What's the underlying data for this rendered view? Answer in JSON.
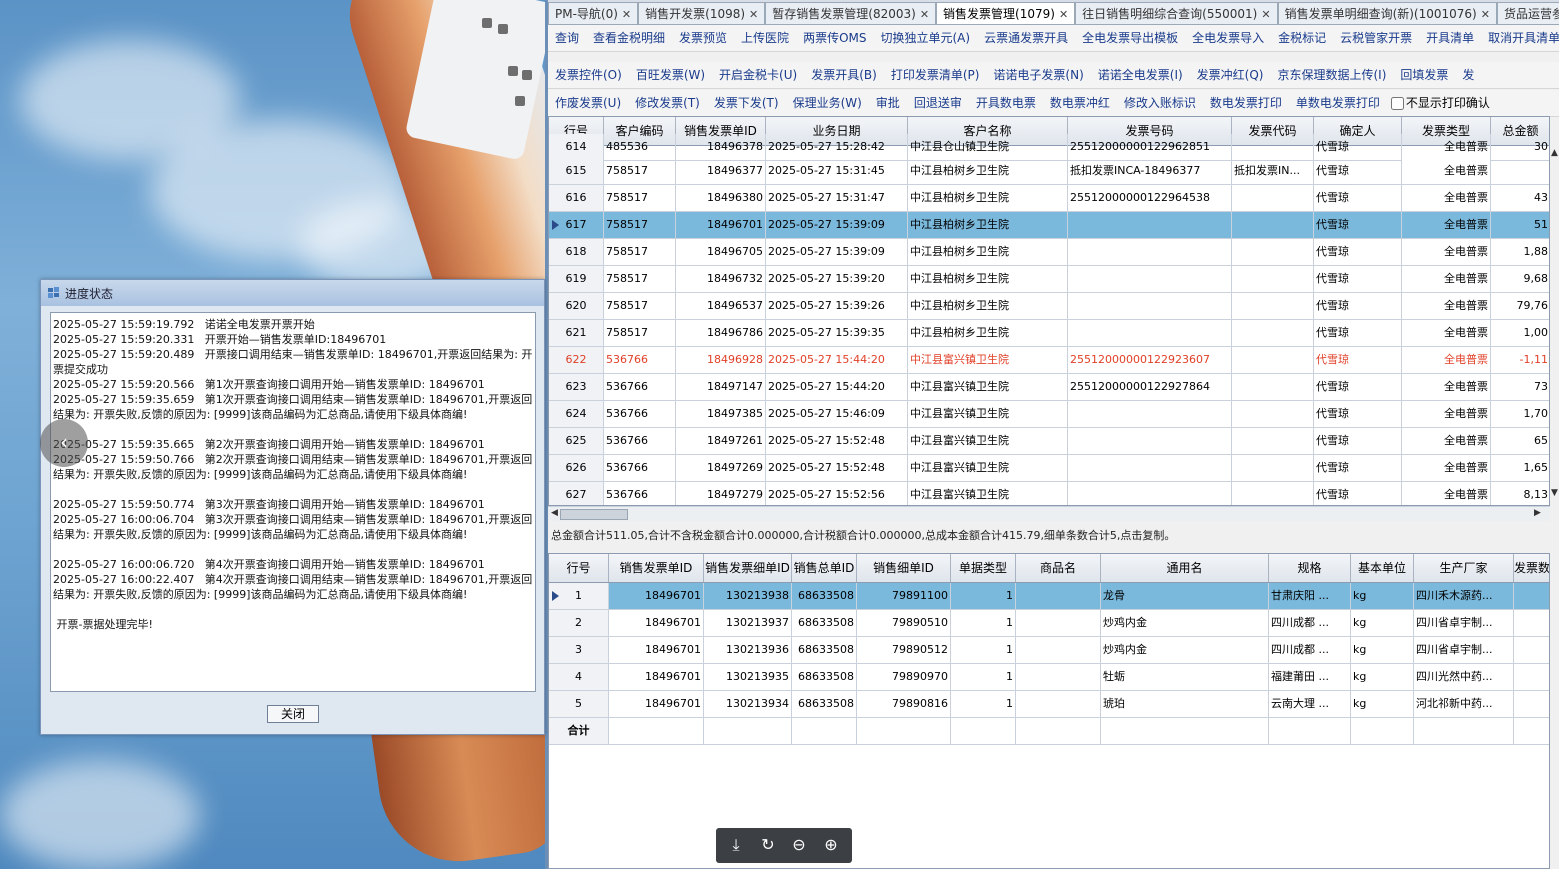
{
  "tabs": [
    {
      "label": "PM-导航(0)"
    },
    {
      "label": "销售开发票(1098)"
    },
    {
      "label": "暂存销售发票管理(82003)"
    },
    {
      "label": "销售发票管理(1079)",
      "active": true
    },
    {
      "label": "往日销售明细综合查询(550001)"
    },
    {
      "label": "销售发票单明细查询(新)(1001076)"
    },
    {
      "label": "货品运营参数设置"
    }
  ],
  "toolbar1": [
    "查询",
    "查看金税明细",
    "发票预览",
    "上传医院",
    "两票传OMS",
    "切换独立单元(A)",
    "云票通发票开具",
    "全电发票导出模板",
    "全电发票导入",
    "金税标记",
    "云税管家开票",
    "开具清单",
    "取消开具清单"
  ],
  "toolbar2": [
    "发票控件(O)",
    "百旺发票(W)",
    "开启金税卡(U)",
    "发票开具(B)",
    "打印发票清单(P)",
    "诺诺电子发票(N)",
    "诺诺全电发票(I)",
    "发票冲红(Q)",
    "京东保理数据上传(I)",
    "回填发票",
    "发"
  ],
  "toolbar3": [
    "作废发票(U)",
    "修改发票(T)",
    "发票下发(T)",
    "保理业务(W)",
    "审批",
    "回退送审",
    "开具数电票",
    "数电票冲红",
    "修改入账标识",
    "数电发票打印",
    "单数电发票打印"
  ],
  "toolbar3_checkbox": "不显示打印确认",
  "main_grid": {
    "headers": [
      "行号",
      "客户编码",
      "销售发票单ID",
      "业务日期",
      "客户名称",
      "发票号码",
      "发票代码",
      "确定人",
      "发票类型",
      "总金额"
    ],
    "partial_row": [
      "614",
      "485536",
      "18496378",
      "2025-05-27 15:28:42",
      "中江县仓山镇卫生院",
      "25512000000122962851",
      "",
      "代雪琼",
      "全电普票",
      "30"
    ],
    "rows": [
      [
        "615",
        "758517",
        "18496377",
        "2025-05-27 15:31:45",
        "中江县柏树乡卫生院",
        "抵扣发票INCA-18496377",
        "抵扣发票IN...",
        "代雪琼",
        "全电普票",
        ""
      ],
      [
        "616",
        "758517",
        "18496380",
        "2025-05-27 15:31:47",
        "中江县柏树乡卫生院",
        "25512000000122964538",
        "",
        "代雪琼",
        "全电普票",
        "43"
      ],
      [
        "617",
        "758517",
        "18496701",
        "2025-05-27 15:39:09",
        "中江县柏树乡卫生院",
        "",
        "",
        "代雪琼",
        "全电普票",
        "51"
      ],
      [
        "618",
        "758517",
        "18496705",
        "2025-05-27 15:39:09",
        "中江县柏树乡卫生院",
        "",
        "",
        "代雪琼",
        "全电普票",
        "1,88"
      ],
      [
        "619",
        "758517",
        "18496732",
        "2025-05-27 15:39:20",
        "中江县柏树乡卫生院",
        "",
        "",
        "代雪琼",
        "全电普票",
        "9,68"
      ],
      [
        "620",
        "758517",
        "18496537",
        "2025-05-27 15:39:26",
        "中江县柏树乡卫生院",
        "",
        "",
        "代雪琼",
        "全电普票",
        "79,76"
      ],
      [
        "621",
        "758517",
        "18496786",
        "2025-05-27 15:39:35",
        "中江县柏树乡卫生院",
        "",
        "",
        "代雪琼",
        "全电普票",
        "1,00"
      ],
      [
        "622",
        "536766",
        "18496928",
        "2025-05-27 15:44:20",
        "中江县富兴镇卫生院",
        "25512000000122923607",
        "",
        "代雪琼",
        "全电普票",
        "-1,11"
      ],
      [
        "623",
        "536766",
        "18497147",
        "2025-05-27 15:44:20",
        "中江县富兴镇卫生院",
        "25512000000122927864",
        "",
        "代雪琼",
        "全电普票",
        "73"
      ],
      [
        "624",
        "536766",
        "18497385",
        "2025-05-27 15:46:09",
        "中江县富兴镇卫生院",
        "",
        "",
        "代雪琼",
        "全电普票",
        "1,70"
      ],
      [
        "625",
        "536766",
        "18497261",
        "2025-05-27 15:52:48",
        "中江县富兴镇卫生院",
        "",
        "",
        "代雪琼",
        "全电普票",
        "65"
      ],
      [
        "626",
        "536766",
        "18497269",
        "2025-05-27 15:52:48",
        "中江县富兴镇卫生院",
        "",
        "",
        "代雪琼",
        "全电普票",
        "1,65"
      ],
      [
        "627",
        "536766",
        "18497279",
        "2025-05-27 15:52:56",
        "中江县富兴镇卫生院",
        "",
        "",
        "代雪琼",
        "全电普票",
        "8,13"
      ]
    ],
    "selected_row": "617",
    "red_row": "622"
  },
  "summary": "总金额合计511.05,合计不含税金额合计0.000000,合计税额合计0.000000,总成本金额合计415.79,细单条数合计5,点击复制。",
  "detail_grid": {
    "headers": [
      "行号",
      "销售发票单ID",
      "销售发票细单ID",
      "销售总单ID",
      "销售细单ID",
      "单据类型",
      "商品名",
      "通用名",
      "规格",
      "基本单位",
      "生产厂家",
      "发票数"
    ],
    "rows": [
      [
        "1",
        "18496701",
        "130213938",
        "68633508",
        "79891100",
        "1",
        "",
        "龙骨",
        "甘肃庆阳 ...",
        "kg",
        "四川禾木源药..."
      ],
      [
        "2",
        "18496701",
        "130213937",
        "68633508",
        "79890510",
        "1",
        "",
        "炒鸡内金",
        "四川成都 ...",
        "kg",
        "四川省卓宇制..."
      ],
      [
        "3",
        "18496701",
        "130213936",
        "68633508",
        "79890512",
        "1",
        "",
        "炒鸡内金",
        "四川成都 ...",
        "kg",
        "四川省卓宇制..."
      ],
      [
        "4",
        "18496701",
        "130213935",
        "68633508",
        "79890970",
        "1",
        "",
        "牡蛎",
        "福建莆田 ...",
        "kg",
        "四川光然中药..."
      ],
      [
        "5",
        "18496701",
        "130213934",
        "68633508",
        "79890816",
        "1",
        "",
        "琥珀",
        "云南大理 ...",
        "kg",
        "河北祁新中药..."
      ]
    ],
    "total_label": "合计"
  },
  "dialog": {
    "title": "进度状态",
    "log": [
      "2025-05-27 15:59:19.792   诺诺全电发票开票开始",
      "2025-05-27 15:59:20.331   开票开始—销售发票单ID:18496701",
      "2025-05-27 15:59:20.489   开票接口调用结束—销售发票单ID: 18496701,开票返回结果为: 开票提交成功",
      "2025-05-27 15:59:20.566   第1次开票查询接口调用开始—销售发票单ID: 18496701",
      "2025-05-27 15:59:35.659   第1次开票查询接口调用结束—销售发票单ID: 18496701,开票返回结果为: 开票失败,反馈的原因为: [9999]该商品编码为汇总商品,请使用下级具体商编!",
      "2025-05-27 15:59:35.665   第2次开票查询接口调用开始—销售发票单ID: 18496701",
      "2025-05-27 15:59:50.766   第2次开票查询接口调用结束—销售发票单ID: 18496701,开票返回结果为: 开票失败,反馈的原因为: [9999]该商品编码为汇总商品,请使用下级具体商编!",
      "2025-05-27 15:59:50.774   第3次开票查询接口调用开始—销售发票单ID: 18496701",
      "2025-05-27 16:00:06.704   第3次开票查询接口调用结束—销售发票单ID: 18496701,开票返回结果为: 开票失败,反馈的原因为: [9999]该商品编码为汇总商品,请使用下级具体商编!",
      "2025-05-27 16:00:06.720   第4次开票查询接口调用开始—销售发票单ID: 18496701",
      "2025-05-27 16:00:22.407   第4次开票查询接口调用结束—销售发票单ID: 18496701,开票返回结果为: 开票失败,反馈的原因为: [9999]该商品编码为汇总商品,请使用下级具体商编!",
      " 开票-票据处理完毕!"
    ],
    "close_label": "关闭"
  },
  "viewer_icons": [
    "download-icon",
    "rotate-icon",
    "zoom-out-icon",
    "zoom-in-icon"
  ],
  "colors": {
    "selected_row": "#7ab8dc",
    "red_text": "#e04028",
    "link_text": "#1a3b8c"
  }
}
